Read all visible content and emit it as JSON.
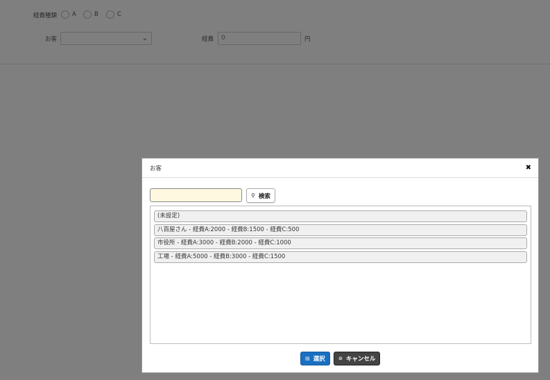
{
  "background_form": {
    "expense_type_label": "経費種類",
    "radio_options": [
      "A",
      "B",
      "C"
    ],
    "customer_label": "お客",
    "customer_select_value": "",
    "expense_label": "経費",
    "expense_value": "0",
    "expense_unit": "円"
  },
  "modal": {
    "title": "お客",
    "close_icon": "close-icon",
    "search": {
      "value": "",
      "button_label": "検索",
      "button_icon": "search-icon"
    },
    "items": [
      "(未設定)",
      "八百屋さん - 経費A:2000 - 経費B:1500 - 経費C:500",
      "市役所 - 経費A:3000 - 経費B:2000 - 経費C:1000",
      "工場 - 経費A:5000 - 経費B:3000 - 経費C:1500"
    ],
    "select_button": {
      "label": "選択",
      "icon": "save-icon"
    },
    "cancel_button": {
      "label": "キャンセル",
      "icon": "cancel-icon"
    }
  },
  "colors": {
    "primary_button": "#1a6fc0",
    "cancel_button": "#444444",
    "search_input_bg": "#fff8e1",
    "overlay": "rgba(0,0,0,0.5)"
  }
}
